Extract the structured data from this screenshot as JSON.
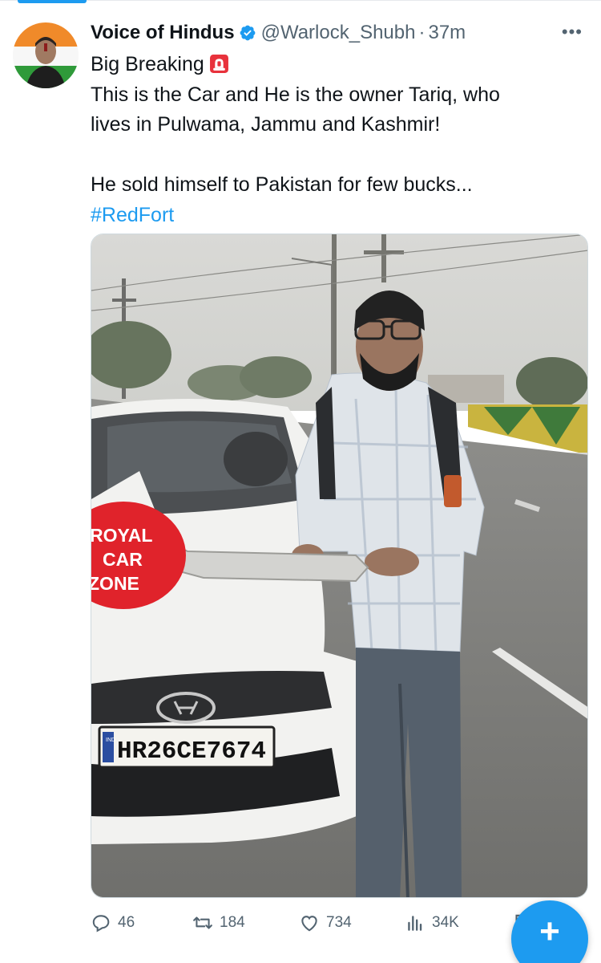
{
  "tweet": {
    "author": {
      "display_name": "Voice of Hindus",
      "handle": "@Warlock_Shubh",
      "separator": "·",
      "time": "37m",
      "verified": true,
      "avatar_icon": "profile-avatar"
    },
    "text_lines": [
      "Big Breaking",
      "This is the Car and He is the owner Tariq, who",
      "lives in Pulwama, Jammu and Kashmir!",
      "",
      "He sold himself to Pakistan for few bucks...",
      "#RedFort"
    ],
    "photo": {
      "sign_text": [
        "ROYAL",
        "CAR",
        "ZONE"
      ],
      "plate_text": "HR26CE7674",
      "plate_prefix": "IND"
    },
    "actions": {
      "replies": "46",
      "reposts": "184",
      "likes": "734",
      "views": "34K"
    }
  },
  "icons": {
    "verified": "verified-badge-icon",
    "siren": "siren-emoji-icon",
    "more": "more-icon",
    "reply": "reply-icon",
    "repost": "repost-icon",
    "like": "like-icon",
    "views": "views-icon",
    "compose": "compose-plus-icon"
  },
  "colors": {
    "accent": "#1d9bf0",
    "text": "#0f1419",
    "secondary": "#536471"
  }
}
